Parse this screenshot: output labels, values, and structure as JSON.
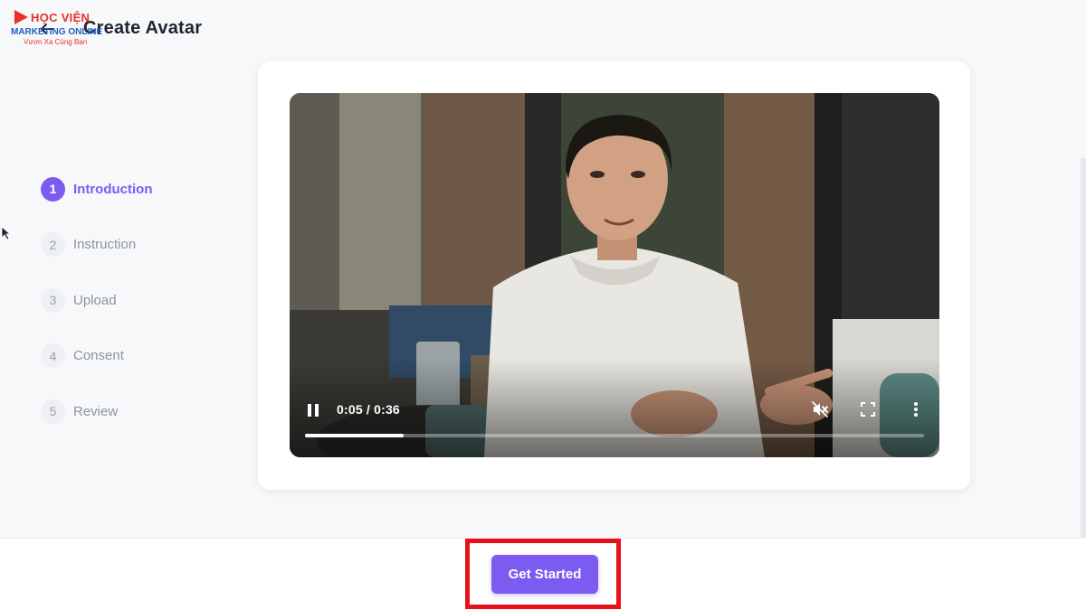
{
  "header": {
    "title": "Create Avatar"
  },
  "watermark": {
    "line1": "HỌC VIỆN",
    "line2": "MARKETING ONLINE",
    "line3": "Vươn Xa Cùng Bạn"
  },
  "steps": [
    {
      "number": "1",
      "label": "Introduction",
      "active": true
    },
    {
      "number": "2",
      "label": "Instruction",
      "active": false
    },
    {
      "number": "3",
      "label": "Upload",
      "active": false
    },
    {
      "number": "4",
      "label": "Consent",
      "active": false
    },
    {
      "number": "5",
      "label": "Review",
      "active": false
    }
  ],
  "video": {
    "time": "0:05 / 0:36",
    "progress_fraction": 0.16,
    "state": "playing",
    "muted": true
  },
  "footer": {
    "primary_button": "Get Started"
  },
  "colors": {
    "accent": "#7c5cf0",
    "highlight": "#e8101a"
  }
}
